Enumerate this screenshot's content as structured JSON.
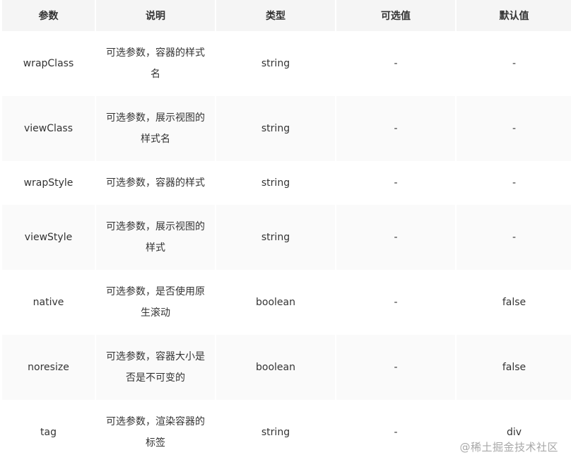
{
  "table": {
    "headers": [
      "参数",
      "说明",
      "类型",
      "可选值",
      "默认值"
    ],
    "rows": [
      {
        "param": "wrapClass",
        "desc": "可选参数，容器的样式名",
        "type": "string",
        "options": "-",
        "default": "-"
      },
      {
        "param": "viewClass",
        "desc": "可选参数，展示视图的样式名",
        "type": "string",
        "options": "-",
        "default": "-"
      },
      {
        "param": "wrapStyle",
        "desc": "可选参数，容器的样式",
        "type": "string",
        "options": "-",
        "default": "-"
      },
      {
        "param": "viewStyle",
        "desc": "可选参数，展示视图的样式",
        "type": "string",
        "options": "-",
        "default": "-"
      },
      {
        "param": "native",
        "desc": "可选参数，是否使用原生滚动",
        "type": "boolean",
        "options": "-",
        "default": "false"
      },
      {
        "param": "noresize",
        "desc": "可选参数，容器大小是否是不可变的",
        "type": "boolean",
        "options": "-",
        "default": "false"
      },
      {
        "param": "tag",
        "desc": "可选参数，渲染容器的标签",
        "type": "string",
        "options": "-",
        "default": "div"
      }
    ]
  },
  "watermark": {
    "text": "@稀土掘金技术社区"
  }
}
